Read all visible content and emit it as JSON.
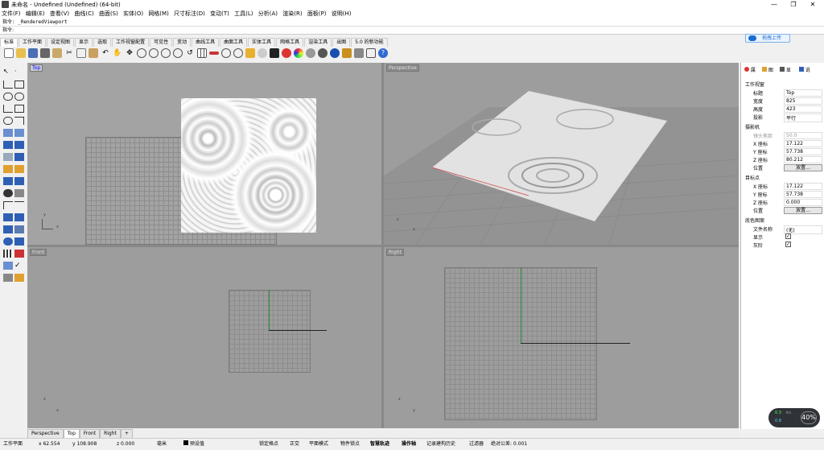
{
  "title": "未命名 - Undefined (Undefined) (64-bit)",
  "menu": [
    "文件(F)",
    "编辑(E)",
    "查看(V)",
    "曲线(C)",
    "曲面(S)",
    "实体(O)",
    "网格(M)",
    "尺寸标注(D)",
    "变动(T)",
    "工具(L)",
    "分析(A)",
    "渲染(R)",
    "面板(P)",
    "说明(H)"
  ],
  "command_history": "指令: _RenderedViewport",
  "command_prompt": "指令:",
  "upload_label": "拖拽上传",
  "toolbar_tabs": [
    "标准",
    "工作平面",
    "设定视图",
    "显示",
    "选取",
    "工作视窗配置",
    "可见性",
    "变动",
    "曲线工具",
    "曲面工具",
    "实体工具",
    "网格工具",
    "渲染工具",
    "出图",
    "5.0 的新功能"
  ],
  "viewports": {
    "top": "Top",
    "perspective": "Perspective",
    "front": "Front",
    "right": "Right"
  },
  "axes": {
    "x": "x",
    "y": "y",
    "z": "z"
  },
  "viewport_tabs": [
    "Perspective",
    "Top",
    "Front",
    "Right"
  ],
  "add_tab": "+",
  "panel": {
    "tabs": [
      "属",
      "图",
      "显",
      "说"
    ],
    "section_viewport": "工作视窗",
    "title_label": "标题",
    "title_value": "Top",
    "width_label": "宽度",
    "width_value": "825",
    "height_label": "高度",
    "height_value": "423",
    "projection_label": "投影",
    "projection_value": "平行",
    "section_camera": "摄影机",
    "lens_label": "镜头焦距",
    "lens_value": "50.0",
    "cam_x_label": "X 座标",
    "cam_x": "17.122",
    "cam_y_label": "Y 座标",
    "cam_y": "57.738",
    "cam_z_label": "Z 座标",
    "cam_z": "80.212",
    "cam_pos_label": "位置",
    "cam_pos_btn": "放置...",
    "section_target": "目标点",
    "tgt_x_label": "X 座标",
    "tgt_x": "17.122",
    "tgt_y_label": "Y 座标",
    "tgt_y": "57.738",
    "tgt_z_label": "Z 座标",
    "tgt_z": "0.000",
    "tgt_pos_label": "位置",
    "tgt_pos_btn": "放置...",
    "section_wallpaper": "底色图案",
    "file_label": "文件名称",
    "file_value": "(无)",
    "show_label": "显示",
    "gray_label": "灰阶"
  },
  "status": {
    "plane": "工作平面",
    "x": "x 62.554",
    "y": "y 108.908",
    "z": "z 0.000",
    "unit": "毫米",
    "layer": "预设值",
    "snap": "锁定格点",
    "ortho": "正交",
    "planar": "平面模式",
    "osnap": "物件锁点",
    "smarttrack": "智慧轨迹",
    "gumball": "操作轴",
    "history": "记录建构历史",
    "filter": "过滤器",
    "tolerance": "绝对公差: 0.001"
  },
  "perf": {
    "up": "0.3",
    "down": "0.8",
    "unit": "K/s",
    "percent": "40%"
  }
}
